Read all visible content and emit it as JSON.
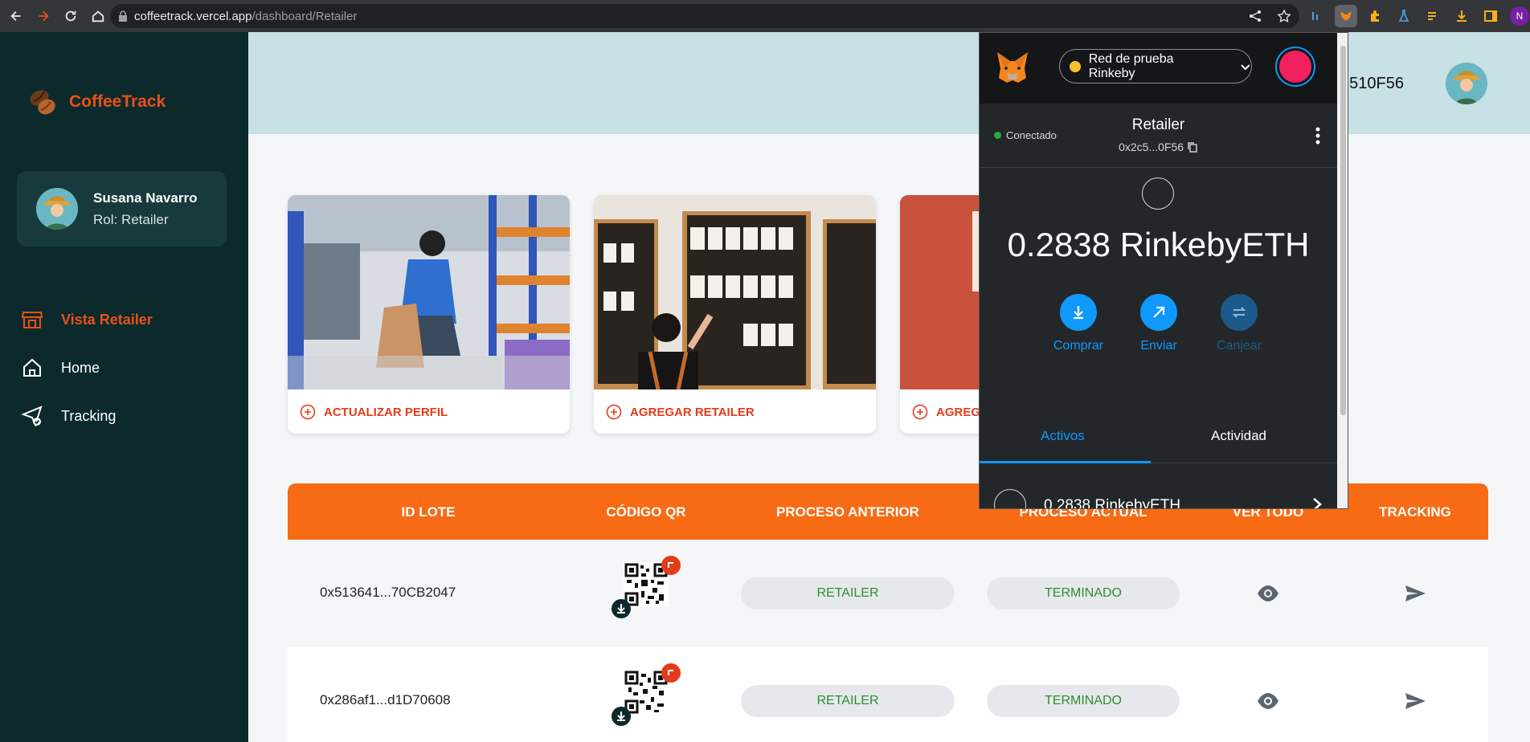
{
  "browser": {
    "url_host": "coffeetrack.vercel.app",
    "url_path": "/dashboard/Retailer",
    "profile_initial": "N"
  },
  "sidebar": {
    "brand": "CoffeeTrack",
    "user": {
      "name": "Susana Navarro",
      "role": "Rol: Retailer"
    },
    "items": [
      {
        "label": "Vista Retailer",
        "icon": "store-icon"
      },
      {
        "label": "Home",
        "icon": "home-icon"
      },
      {
        "label": "Tracking",
        "icon": "send-check-icon"
      }
    ]
  },
  "header": {
    "address_fragment": "5510F56"
  },
  "cards": [
    {
      "action": "ACTUALIZAR PERFIL"
    },
    {
      "action": "AGREGAR RETAILER"
    },
    {
      "action": "AGREG"
    }
  ],
  "table": {
    "columns": [
      "ID LOTE",
      "CÓDIGO QR",
      "PROCESO ANTERIOR",
      "PROCESO ACTUAL",
      "VER TODO",
      "TRACKING"
    ],
    "rows": [
      {
        "id": "0x513641...70CB2047",
        "prev": "RETAILER",
        "current": "TERMINADO"
      },
      {
        "id": "0x286af1...d1D70608",
        "prev": "RETAILER",
        "current": "TERMINADO"
      }
    ]
  },
  "metamask": {
    "network": "Red de prueba Rinkeby",
    "connected": "Conectado",
    "account_name": "Retailer",
    "account_address": "0x2c5...0F56",
    "balance": "0.2838 RinkebyETH",
    "actions": [
      {
        "label": "Comprar",
        "icon": "download-icon"
      },
      {
        "label": "Enviar",
        "icon": "arrow-up-right-icon"
      },
      {
        "label": "Canjear",
        "icon": "swap-icon"
      }
    ],
    "tabs": [
      "Activos",
      "Actividad"
    ],
    "asset": "0.2838 RinkebyETH"
  },
  "colors": {
    "sidebar_bg": "#0c2a2c",
    "accent": "#e8501a",
    "table_header": "#f76b15",
    "mm_blue": "#1098fc"
  }
}
